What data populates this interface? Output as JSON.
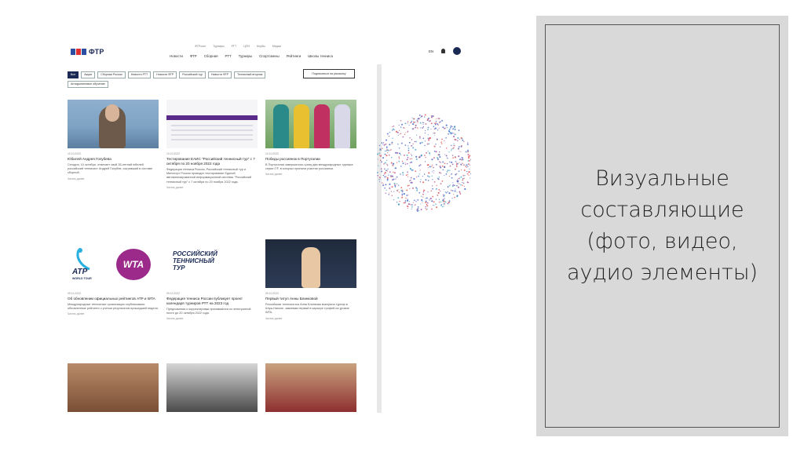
{
  "slide": {
    "heading_lines": [
      "Визуальные",
      "составляющие",
      "(фото, видео,",
      "аудио элементы)"
    ]
  },
  "site": {
    "logo_text": "ФТР",
    "top_nav": [
      "ФТР.com",
      "Турниры",
      "РТТ",
      "ЦПН",
      "Клубы",
      "Медиа"
    ],
    "main_nav": [
      "Новости",
      "ФТР",
      "Сборная",
      "РТТ",
      "Турниры",
      "Спортсмены",
      "Рейтинги",
      "Школы тенниса"
    ],
    "lang": "EN",
    "filters": [
      "Все",
      "Акции",
      "Сборная России",
      "Новости РТТ",
      "Новости ФТР",
      "Российский тур",
      "Новости ФТР",
      "Теннисный вторник",
      "Антидопинговое обучение"
    ],
    "subscribe_label": "Подписаться на рассылку",
    "cards": [
      {
        "date": "10.10.2022",
        "title": "Юбилей Андрея Голубева",
        "text": "Сегодня, 10 октября, отмечает свой 35-летний юбилей российский теннисист Андрей Голубев, сыгравший в составе сборной.",
        "more": "Читать далее"
      },
      {
        "date": "10.10.2022",
        "title": "Тестирование ЕАИС \"Российский теннисный тур\" с 7 октября по 20 ноября 2022 года",
        "text": "Федерация тенниса России, Российский теннисный тур и Минспорт России проводят тестирование Единой автоматизированной информационной системы \"Российский теннисный тур\" с 7 октября по 20 ноября 2022 года.",
        "more": "Читать далее"
      },
      {
        "date": "10.10.2022",
        "title": "Победы россиянок в Португалии",
        "text": "В Португалии завершились сразу два международных турнира серии ITF, в которых приняли участие россиянки.",
        "more": "Читать далее"
      },
      {
        "date": "09.10.2022",
        "title": "Об обновлении официальных рейтингов ATP и WTA",
        "text": "Международные теннисные организации опубликовали обновленные рейтинги с учетом результатов прошедшей недели.",
        "more": "Читать далее"
      },
      {
        "date": "09.10.2022",
        "title": "Федерация тенниса России публикует проект календаря турниров РТТ на 2023 год",
        "text": "Предложения и корректировки принимаются по электронной почте до 20 октября 2022 года.",
        "more": "Читать далее"
      },
      {
        "date": "09.10.2022",
        "title": "Первый титул Анны Блинковой",
        "text": "Российская теннисистка Анна Блинкова выиграла турнир в Клуж-Напоке, завоевав первый в карьере трофей на уровне WTA.",
        "more": "Читать далее"
      }
    ],
    "logo_texts": {
      "wta": "WTA",
      "atp": "ATP",
      "atp_sub": "WORLD TOUR",
      "rtt_line1": "РОССИЙСКИЙ",
      "rtt_line2": "ТЕННИСНЫЙ",
      "rtt_line3": "ТУР"
    }
  },
  "colors": {
    "brand_navy": "#1b2a55",
    "wta_purple": "#9b2a8a",
    "panel_gray": "#d9d9d9"
  }
}
